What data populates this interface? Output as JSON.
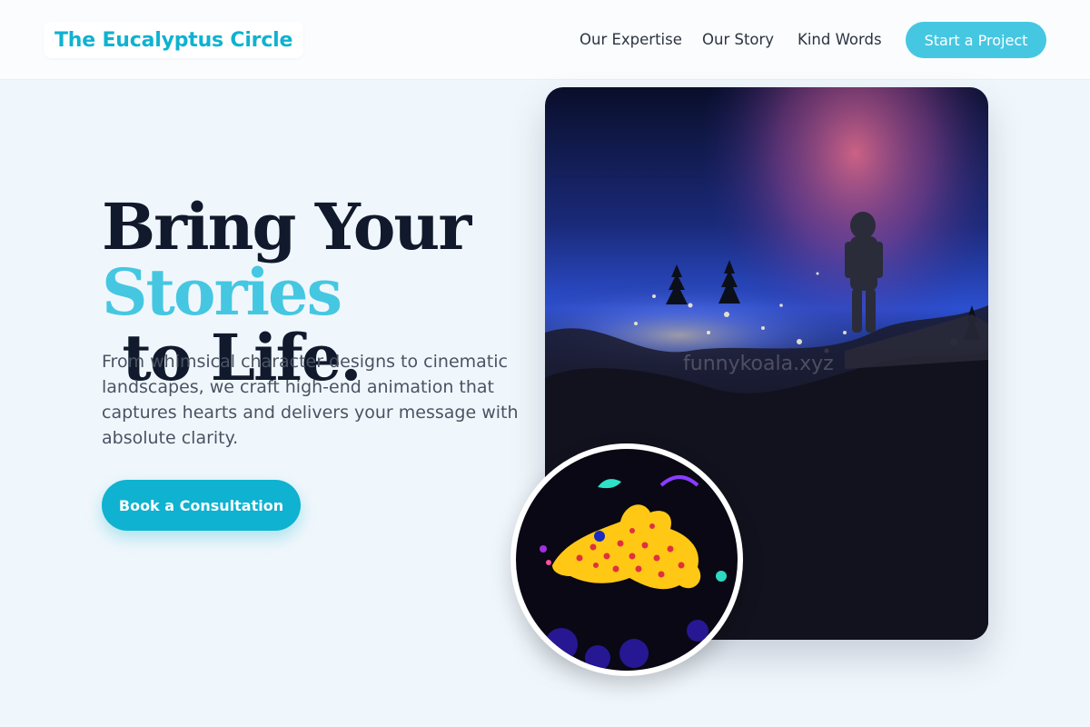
{
  "header": {
    "logo": "The Eucalyptus Circle",
    "nav": [
      "Our Expertise",
      "Our Story",
      "Kind Words"
    ],
    "cta": "Start a Project"
  },
  "hero": {
    "title_line1": "Bring Your",
    "title_accent": "Stories",
    "title_rest": " to Life.",
    "description": "From whimsical character designs to cinematic landscapes, we craft high-end animation that captures hearts and delivers your message with absolute clarity.",
    "cta": "Book a Consultation"
  },
  "images": {
    "main_watermark": "funnykoala.xyz",
    "main_subject": "astronaut overlooking night city",
    "circle_subject": "yellow spotted creature"
  },
  "colors": {
    "brand": "#0fb2d0",
    "accent": "#45c7e2",
    "heading": "#111a2c",
    "background": "#f0f7fc"
  }
}
